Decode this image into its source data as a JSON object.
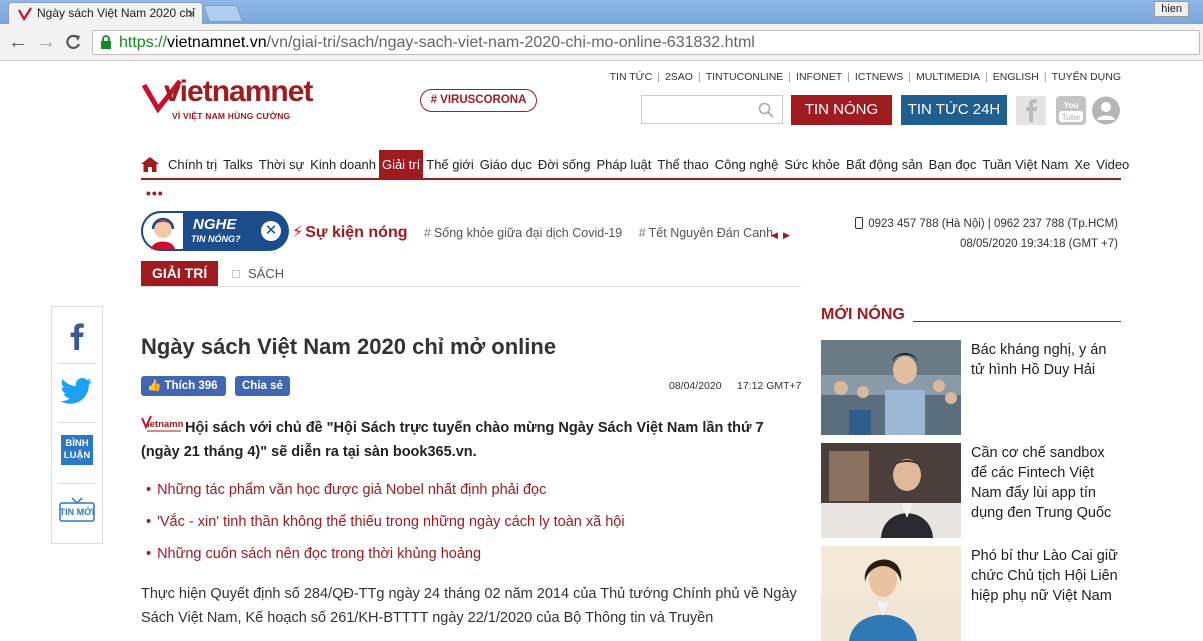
{
  "browser": {
    "tab_title": "Ngày sách Việt Nam 2020 chỉ",
    "tab_close": "×",
    "user": "hien",
    "url_scheme": "https://",
    "url_host": "vietnamnet.vn",
    "url_path": "/vn/giai-tri/sach/ngay-sach-viet-nam-2020-chi-mo-online-631832.html"
  },
  "header": {
    "logo_text": "vietnamnet",
    "slogan": "VÌ VIỆT NAM HÙNG CƯỜNG",
    "viruscorona": "# VIRUSCORONA",
    "top_links": [
      "TIN TỨC",
      "2SAO",
      "TINTUCONLINE",
      "INFONET",
      "ICTNEWS",
      "MULTIMEDIA",
      "ENGLISH",
      "TUYỂN DỤNG"
    ],
    "btn_hot": "TIN NÓNG",
    "btn_24h": "TIN TỨC 24H"
  },
  "nav": {
    "items": [
      "Chính trị",
      "Talks",
      "Thời sự",
      "Kinh doanh",
      "Giải trí",
      "Thế giới",
      "Giáo dục",
      "Đời sống",
      "Pháp luật",
      "Thể thao",
      "Công nghệ",
      "Sức khỏe",
      "Bất động sản",
      "Bạn đọc",
      "Tuần Việt Nam",
      "Xe",
      "Video"
    ],
    "active_index": 4,
    "more": "•••"
  },
  "hotbar": {
    "nghe_line1": "NGHE",
    "nghe_line2": "TIN NÓNG?",
    "close": "✕",
    "label": "Sự kiện nóng",
    "tags": [
      "Sống khỏe giữa đại dịch Covid-19",
      "Tết Nguyên Đán Canh"
    ],
    "prev": "◀",
    "next": "▶"
  },
  "contact": {
    "phones": "0923 457 788 (Hà Nội) | 0962 237 788 (Tp.HCM)",
    "datetime": "08/05/2020 19:34:18 (GMT +7)"
  },
  "breadcrumb": {
    "category": "GIẢI TRÍ",
    "sub": "SÁCH"
  },
  "sharebar": {
    "binh_luan_1": "BÌNH",
    "binh_luan_2": "LUẬN",
    "tin_moi": "TIN MỚI"
  },
  "article": {
    "title": "Ngày sách Việt Nam 2020 chỉ mở online",
    "like_label": "Thích 396",
    "share_label": "Chia sẻ",
    "date": "08/04/2020",
    "time": "17:12 GMT+7",
    "sapo": "Hội sách với chủ đề \"Hội Sách trực tuyến chào mừng Ngày Sách Việt Nam lần thứ 7 (ngày 21 tháng 4)\" sẽ diễn ra tại sàn book365.vn.",
    "related": [
      "Những tác phẩm văn học được giả Nobel nhất định phải đọc",
      "'Vắc - xin' tinh thần không thể thiếu trong những ngày cách ly toàn xã hội",
      "Những cuốn sách nên đọc trong thời khủng hoảng"
    ],
    "body": "Thực hiện Quyết định số 284/QĐ-TTg ngày 24 tháng 02 năm 2014 của Thủ tướng Chính phủ về Ngày Sách Việt Nam, Kế hoạch số 261/KH-BTTTT ngày 22/1/2020 của Bộ Thông tin và Truyền"
  },
  "sidebar": {
    "title": "MỚI NÓNG",
    "news": [
      "Bác kháng nghị, y án tử hình Hồ Duy Hải",
      "Cần cơ chế sandbox để các Fintech Việt Nam đẩy lùi app tín dụng đen Trung Quốc",
      "Phó bí thư Lào Cai giữ chức Chủ tịch Hội Liên hiệp phụ nữ Việt Nam"
    ]
  },
  "colors": {
    "brand": "#9e1b20",
    "blue": "#1f5f8f",
    "fb": "#4267b2"
  }
}
